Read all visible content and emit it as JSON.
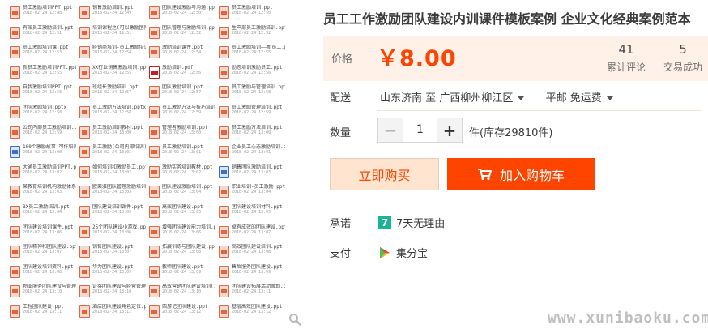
{
  "thumbnail": {
    "files": [
      {
        "name": "员工激励培训PPT.ppt",
        "date": "2018-02-24 12:48",
        "icon": "ppt"
      },
      {
        "name": "销售激励培训.ppt",
        "date": "2018-02-24 12:49",
        "icon": "ppt"
      },
      {
        "name": "团队建设激励与沟通.ppt",
        "date": "2018-02-24 12:50",
        "icon": "ppt"
      },
      {
        "name": "员工激励培训.ppt",
        "date": "2018-02-24 12:50",
        "icon": "ppt"
      },
      {
        "name": "有效员工激励培训.ppt",
        "date": "2018-02-24 12:51",
        "icon": "ppt"
      },
      {
        "name": "培训课程之(可以激励团队最棒)ppt",
        "date": "2018-02-24 12:51",
        "icon": "ppt"
      },
      {
        "name": "团队管理与激励培训.ppt",
        "date": "2018-02-24 12:52",
        "icon": "ppt"
      },
      {
        "name": "生产部员工激励培训.ppt",
        "date": "2018-02-24 12:52",
        "icon": "ppt"
      },
      {
        "name": "员工激励培训课.ppt",
        "date": "2018-02-24 12:53",
        "icon": "ppt"
      },
      {
        "name": "经销商培训-员工激励培训.ppt",
        "date": "2018-02-24 12:54",
        "icon": "ppt"
      },
      {
        "name": "激励培训课件.ppt",
        "date": "2018-02-24 12:54",
        "icon": "ppt"
      },
      {
        "name": "员工激励培训——新员工.ppt",
        "date": "2018-02-24 12:55",
        "icon": "ppt"
      },
      {
        "name": "新员工激励培训PPT.ppt",
        "date": "2018-02-24 12:55",
        "icon": "ppt"
      },
      {
        "name": "XX行业销售激励培训.ppt",
        "date": "2018-02-24 12:55",
        "icon": "ppt"
      },
      {
        "name": "激励培训.pdf",
        "date": "2018-02-24 12:56",
        "icon": "pdf"
      },
      {
        "name": "励志培训激励员工.ppt",
        "date": "2018-02-24 12:56",
        "icon": "ppt"
      },
      {
        "name": "自我激励培训PPT.ppt",
        "date": "2018-02-24 12:56",
        "icon": "ppt"
      },
      {
        "name": "班组长激励培训.ppt",
        "date": "2018-02-24 12:57",
        "icon": "ppt"
      },
      {
        "name": "团队激励培训.ppt",
        "date": "2018-02-24 12:57",
        "icon": "ppt"
      },
      {
        "name": "员工激励与管理培训.ppt",
        "date": "2018-02-24 12:58",
        "icon": "ppt"
      },
      {
        "name": "团队激励培训.pptx",
        "date": "2018-02-24 12:58",
        "icon": "ppt"
      },
      {
        "name": "员工激励方法培训.pptx",
        "date": "2018-02-24 12:58",
        "icon": "ppt"
      },
      {
        "name": "员工激励方法与技巧培训.ppt",
        "date": "2018-02-24 12:59",
        "icon": "ppt"
      },
      {
        "name": "员工激励管理培训.ppt",
        "date": "2018-02-24 12:59",
        "icon": "ppt"
      },
      {
        "name": "公司内部员工激励培训.ppt",
        "date": "2018-02-24 12:59",
        "icon": "ppt"
      },
      {
        "name": "员工激励培训教材.ppt",
        "date": "2018-02-24 13:00",
        "icon": "ppt"
      },
      {
        "name": "管理者激励培训.ppt",
        "date": "2018-02-24 13:00",
        "icon": "ppt"
      },
      {
        "name": "员工激励方法培训.ppt",
        "date": "2018-02-24 13:00",
        "icon": "ppt"
      },
      {
        "name": "100个激励故事-可作培训用.doc",
        "date": "2018-02-24 13:00",
        "icon": "word"
      },
      {
        "name": "员工激励(公司内部培训).ppt",
        "date": "2018-02-24 13:01",
        "icon": "ppt"
      },
      {
        "name": "员工激励培训.ppt",
        "date": "2018-02-24 13:01",
        "icon": "ppt"
      },
      {
        "name": "企业员工心态激励培训.ppt",
        "date": "2018-02-24 13:01",
        "icon": "ppt"
      },
      {
        "name": "大通员工激励培训PPT.ppt",
        "date": "2018-02-24 13:02",
        "icon": "ppt"
      },
      {
        "name": "如何培训和激励员工.ppt",
        "date": "2018-02-24 13:02",
        "icon": "ppt"
      },
      {
        "name": "激励实务培训教材.ppt",
        "date": "2018-02-24 13:02",
        "icon": "ppt"
      },
      {
        "name": "销售团队激励培训.ppt",
        "date": "2018-02-24 13:03",
        "icon": "word"
      },
      {
        "name": "某教育培训机构激励体系构建方案.pptx",
        "date": "2018-02-24 13:03",
        "icon": "ppt"
      },
      {
        "name": "欧莱雅团队管理激励培训方案.ppt",
        "date": "2018-02-24 13:03",
        "icon": "ppt"
      },
      {
        "name": "团队建设激励培训.ppt",
        "date": "2018-02-24 13:04",
        "icon": "ppt"
      },
      {
        "name": "职业培训-员工激励.pptx",
        "date": "2018-02-24 13:04",
        "icon": "ppt"
      },
      {
        "name": "BX员工激励培训.ppt",
        "date": "2018-02-24 13:04",
        "icon": "ppt"
      },
      {
        "name": "团队建设培训课件.ppt",
        "date": "2018-02-24 13:05",
        "icon": "ppt"
      },
      {
        "name": "高效团队建设.ppt",
        "date": "2018-02-24 13:05",
        "icon": "ppt"
      },
      {
        "name": "团队建设培训材料.ppt",
        "date": "2018-02-24 13:05",
        "icon": "ppt"
      },
      {
        "name": "团队建设培训课件.ppt",
        "date": "2018-02-24 13:06",
        "icon": "ppt"
      },
      {
        "name": "25个团队建设小游戏.ppt",
        "date": "2018-02-24 13:06",
        "icon": "ppt"
      },
      {
        "name": "增强团队建设能力培训.ppt",
        "date": "2018-02-24 13:06",
        "icon": "ppt"
      },
      {
        "name": "卓有成效的团队建设.ppt",
        "date": "2018-02-24 13:07",
        "icon": "ppt"
      },
      {
        "name": "团队精神和团队建设.ppt",
        "date": "2018-02-24 13:07",
        "icon": "ppt"
      },
      {
        "name": "销售团队建设.ppt",
        "date": "2018-02-24 13:07",
        "icon": "ppt"
      },
      {
        "name": "拓展训练与团队建设.ppt",
        "date": "2018-02-24 13:08",
        "icon": "ppt"
      },
      {
        "name": "高效团队建设培训.ppt",
        "date": "2018-02-24 13:08",
        "icon": "ppt"
      },
      {
        "name": "团队建设培训资料.ppt",
        "date": "2018-02-24 13:08",
        "icon": "ppt"
      },
      {
        "name": "华为团队建设.ppt",
        "date": "2018-02-24 13:09",
        "icon": "ppt"
      },
      {
        "name": "教师团队建设.ppt",
        "date": "2018-02-24 13:09",
        "icon": "ppt"
      },
      {
        "name": "售后服务团队建设.ppt",
        "date": "2018-02-24 13:09",
        "icon": "ppt"
      },
      {
        "name": "物业服务团队建设与管理.ppt",
        "date": "2018-02-24 13:10",
        "icon": "ppt"
      },
      {
        "name": "证券团队建设与经营管理.ppt",
        "date": "2018-02-24 13:10",
        "icon": "ppt"
      },
      {
        "name": "高效营销团队建设培训(1-5).ppt",
        "date": "2018-02-24 13:10",
        "icon": "ppt"
      },
      {
        "name": "团队建设拓展活动策划.ppt",
        "date": "2018-02-24 13:11",
        "icon": "ppt"
      },
      {
        "name": "工程团队建设.ppt",
        "date": "2018-02-24 13:11",
        "icon": "ppt"
      },
      {
        "name": "酒店团队建设角色定位.ppt",
        "date": "2018-02-24 13:11",
        "icon": "ppt"
      },
      {
        "name": "西游记团队建设.ppt",
        "date": "2018-02-24 13:12",
        "icon": "ppt"
      },
      {
        "name": "基层高效团队建设.ppt",
        "date": "2018-02-24 13:12",
        "icon": "ppt"
      }
    ]
  },
  "product": {
    "title": "员工工作激励团队建设内训课件模板案例 企业文化经典案例范本"
  },
  "price": {
    "label": "价格",
    "value": "￥8.00",
    "reviews_count": "41",
    "reviews_label": "累计评论",
    "sales_count": "5",
    "sales_label": "交易成功"
  },
  "delivery": {
    "label": "配送",
    "from": "山东济南",
    "to_word": "至",
    "destination": "广西柳州柳江区",
    "shipping": "平邮 免运费"
  },
  "quantity": {
    "label": "数量",
    "value": "1",
    "minus": "−",
    "plus": "+",
    "stock": "件(库存29810件)"
  },
  "actions": {
    "buy_now": "立即购买",
    "add_to_cart": "加入购物车"
  },
  "promise": {
    "label": "承诺",
    "icon_text": "7",
    "text": "7天无理由"
  },
  "payment": {
    "label": "支付",
    "text": "集分宝"
  },
  "watermark": "www.xunibaoku.com",
  "colors": {
    "accent": "#ff4400",
    "price_bg": "#fff1e8",
    "buy_now_bg": "#ffe4d0"
  }
}
